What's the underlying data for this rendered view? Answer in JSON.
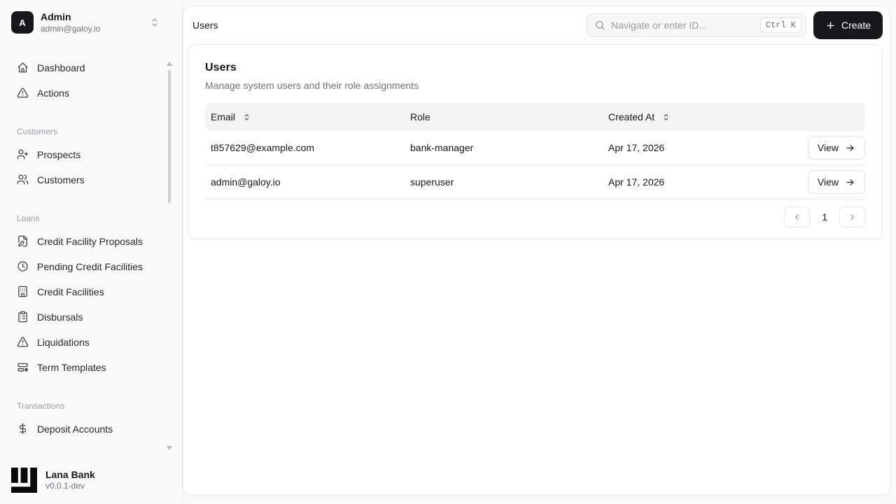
{
  "colors": {
    "accent_black": "#18181b",
    "page_bg": "#fafafa",
    "muted_text": "#71717a",
    "border": "#ececef",
    "table_header_bg": "#f4f4f5"
  },
  "sidebar": {
    "user": {
      "initial": "A",
      "name": "Admin",
      "email": "admin@galoy.io"
    },
    "groups": [
      {
        "label": "",
        "items": [
          {
            "icon": "home-icon",
            "label": "Dashboard"
          },
          {
            "icon": "triangle-alert-icon",
            "label": "Actions"
          }
        ]
      },
      {
        "label": "Customers",
        "items": [
          {
            "icon": "user-plus-icon",
            "label": "Prospects"
          },
          {
            "icon": "users-icon",
            "label": "Customers"
          }
        ]
      },
      {
        "label": "Loans",
        "items": [
          {
            "icon": "file-pen-icon",
            "label": "Credit Facility Proposals"
          },
          {
            "icon": "clock-icon",
            "label": "Pending Credit Facilities"
          },
          {
            "icon": "building-icon",
            "label": "Credit Facilities"
          },
          {
            "icon": "clipboard-list-icon",
            "label": "Disbursals"
          },
          {
            "icon": "triangle-alert-icon",
            "label": "Liquidations"
          },
          {
            "icon": "panels-icon",
            "label": "Term Templates"
          }
        ]
      },
      {
        "label": "Transactions",
        "items": [
          {
            "icon": "dollar-icon",
            "label": "Deposit Accounts"
          }
        ]
      }
    ],
    "footer": {
      "brand": "Lana Bank",
      "version": "v0.0.1-dev"
    }
  },
  "header": {
    "breadcrumb": "Users",
    "search_placeholder": "Navigate or enter ID...",
    "shortcut": "Ctrl K",
    "create_label": "Create"
  },
  "card": {
    "title": "Users",
    "subtitle": "Manage system users and their role assignments"
  },
  "table": {
    "columns": [
      {
        "label": "Email",
        "sortable": true
      },
      {
        "label": "Role",
        "sortable": false
      },
      {
        "label": "Created At",
        "sortable": true
      }
    ],
    "rows": [
      {
        "email": "t857629@example.com",
        "role": "bank-manager",
        "created_at": "Apr 17, 2026",
        "action": "View"
      },
      {
        "email": "admin@galoy.io",
        "role": "superuser",
        "created_at": "Apr 17, 2026",
        "action": "View"
      }
    ]
  },
  "pagination": {
    "current_page": "1"
  }
}
